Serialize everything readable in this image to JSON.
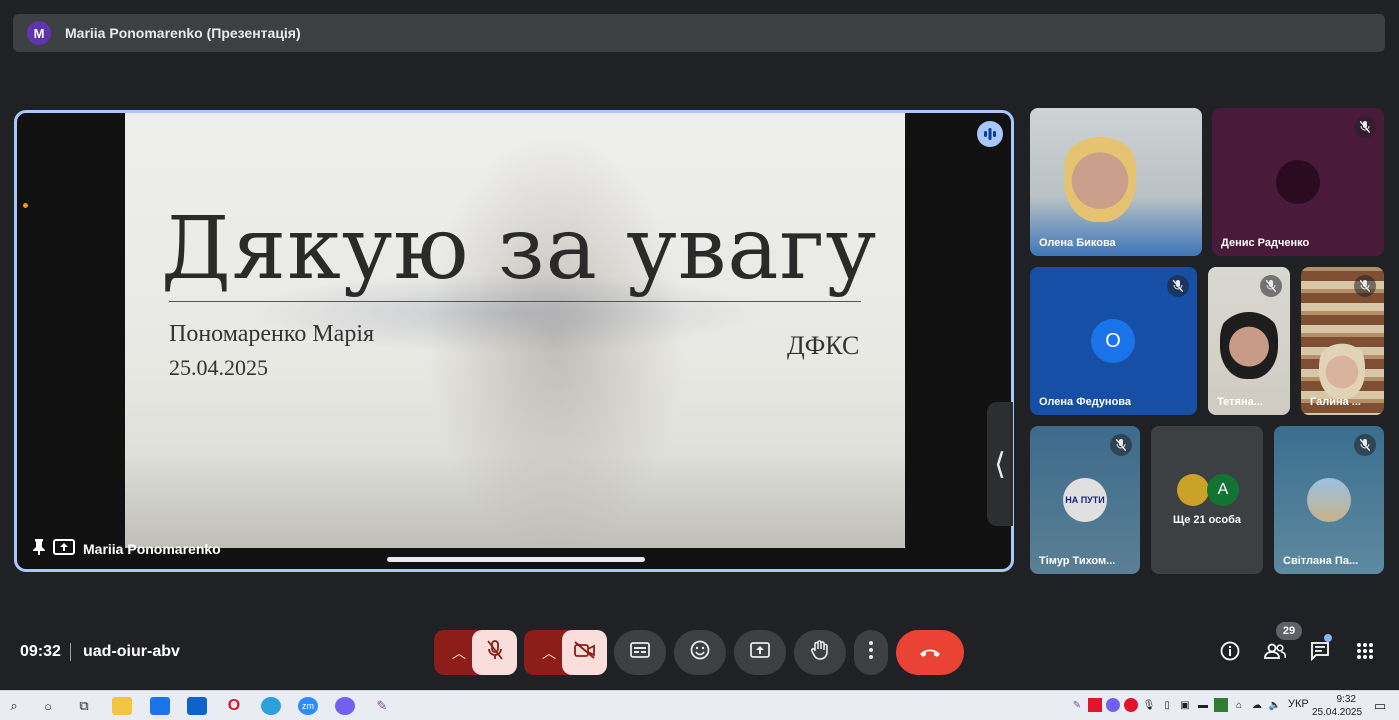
{
  "presenter_bar": {
    "avatar_letter": "M",
    "title": "Mariia Ponomarenko (Презентація)"
  },
  "slide": {
    "title": "Дякую за увагу",
    "author": "Пономаренко Марія",
    "date": "25.04.2025",
    "org": "ДФКС"
  },
  "stage": {
    "label": "Mariia Ponomarenko"
  },
  "participants": [
    {
      "name": "Олена Бикова",
      "muted": false
    },
    {
      "name": "Денис Радченко",
      "muted": true
    },
    {
      "name": "Олена Федунова",
      "muted": true,
      "avatar_letter": "О",
      "avatar_color": "#1a73e8"
    },
    {
      "name": "Тетяна...",
      "muted": true
    },
    {
      "name": "Галина ...",
      "muted": true
    },
    {
      "name": "Тімур Тихом...",
      "muted": true,
      "avatar_text": "НА ПУТИ"
    },
    {
      "name": "Ще 21 особа",
      "avatar_letter": "А",
      "avatar_color": "#137333"
    },
    {
      "name": "Світлана Па...",
      "muted": true
    }
  ],
  "meeting": {
    "time": "09:32",
    "code": "uad-oiur-abv",
    "participants_count": "29"
  },
  "taskbar": {
    "time": "9:32",
    "date": "25.04.2025",
    "lang": "УКР"
  },
  "icons": {
    "speaking": "audio-wave-icon",
    "pin": "pin-icon",
    "present": "present-screen-icon",
    "collapse": "chevron-left-icon",
    "mic_off": "mic-off-icon",
    "cam_off": "camera-off-icon"
  }
}
